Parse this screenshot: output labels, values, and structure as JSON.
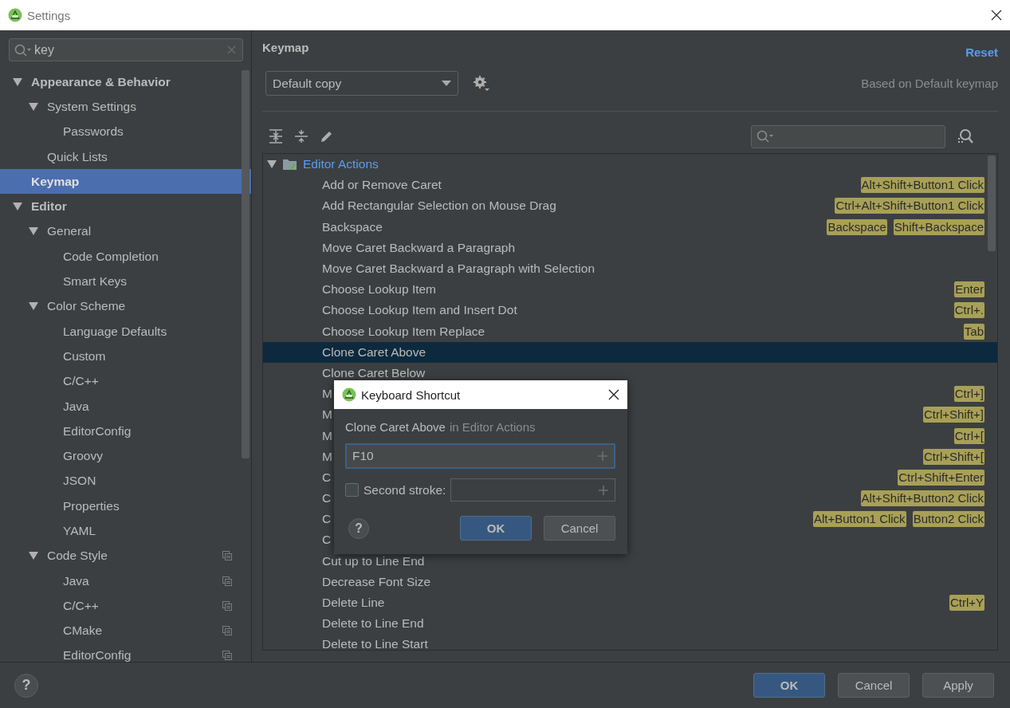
{
  "window": {
    "title": "Settings"
  },
  "sidebar": {
    "search": {
      "value": "key"
    },
    "tree": [
      {
        "label": "Appearance & Behavior",
        "selected": false,
        "expanded": true,
        "children": [
          {
            "label": "System Settings",
            "selected": false,
            "expanded": true,
            "children": [
              {
                "label": "Passwords",
                "selected": false
              }
            ]
          },
          {
            "label": "Quick Lists",
            "selected": false
          }
        ]
      },
      {
        "label": "Keymap",
        "selected": true
      },
      {
        "label": "Editor",
        "selected": false,
        "expanded": true,
        "children": [
          {
            "label": "General",
            "selected": false,
            "expanded": true,
            "children": [
              {
                "label": "Code Completion",
                "selected": false
              },
              {
                "label": "Smart Keys",
                "selected": false
              }
            ]
          },
          {
            "label": "Color Scheme",
            "selected": false,
            "expanded": true,
            "children": [
              {
                "label": "Language Defaults",
                "selected": false
              },
              {
                "label": "Custom",
                "selected": false
              },
              {
                "label": "C/C++",
                "selected": false
              },
              {
                "label": "Java",
                "selected": false
              },
              {
                "label": "EditorConfig",
                "selected": false
              },
              {
                "label": "Groovy",
                "selected": false
              },
              {
                "label": "JSON",
                "selected": false
              },
              {
                "label": "Properties",
                "selected": false
              },
              {
                "label": "YAML",
                "selected": false
              }
            ]
          },
          {
            "label": "Code Style",
            "selected": false,
            "expanded": true,
            "copy_icon": true,
            "children": [
              {
                "label": "Java",
                "selected": false,
                "copy_icon": true
              },
              {
                "label": "C/C++",
                "selected": false,
                "copy_icon": true
              },
              {
                "label": "CMake",
                "selected": false,
                "copy_icon": true
              },
              {
                "label": "EditorConfig",
                "selected": false,
                "copy_icon": true
              }
            ]
          }
        ]
      }
    ]
  },
  "keymap": {
    "title": "Keymap",
    "reset": "Reset",
    "scheme": "Default copy",
    "based_on": "Based on Default keymap",
    "group": {
      "label": "Editor Actions",
      "expanded": true
    },
    "actions": [
      {
        "name": "Add or Remove Caret",
        "selected": false,
        "shortcuts": [
          "Alt+Shift+Button1 Click"
        ]
      },
      {
        "name": "Add Rectangular Selection on Mouse Drag",
        "selected": false,
        "shortcuts": [
          "Ctrl+Alt+Shift+Button1 Click"
        ]
      },
      {
        "name": "Backspace",
        "selected": false,
        "shortcuts": [
          "Backspace",
          "Shift+Backspace"
        ]
      },
      {
        "name": "Move Caret Backward a Paragraph",
        "selected": false
      },
      {
        "name": "Move Caret Backward a Paragraph with Selection",
        "selected": false
      },
      {
        "name": "Choose Lookup Item",
        "selected": false,
        "shortcuts": [
          "Enter"
        ]
      },
      {
        "name": "Choose Lookup Item and Insert Dot",
        "selected": false,
        "shortcuts": [
          "Ctrl+."
        ]
      },
      {
        "name": "Choose Lookup Item Replace",
        "selected": false,
        "shortcuts": [
          "Tab"
        ]
      },
      {
        "name": "Clone Caret Above",
        "selected": true
      },
      {
        "name": "Clone Caret Below",
        "selected": false
      },
      {
        "name": "M",
        "selected": false,
        "shortcuts": [
          "Ctrl+]"
        ]
      },
      {
        "name": "M",
        "selected": false,
        "shortcuts": [
          "Ctrl+Shift+]"
        ]
      },
      {
        "name": "M",
        "selected": false,
        "shortcuts": [
          "Ctrl+["
        ]
      },
      {
        "name": "M",
        "selected": false,
        "shortcuts": [
          "Ctrl+Shift+["
        ]
      },
      {
        "name": "C",
        "selected": false,
        "shortcuts": [
          "Ctrl+Shift+Enter"
        ]
      },
      {
        "name": "C",
        "selected": false,
        "shortcuts": [
          "Alt+Shift+Button2 Click"
        ]
      },
      {
        "name": "C",
        "selected": false,
        "shortcuts": [
          "Alt+Button1 Click",
          "Button2 Click"
        ]
      },
      {
        "name": "C",
        "selected": false
      },
      {
        "name": "Cut up to Line End",
        "selected": false
      },
      {
        "name": "Decrease Font Size",
        "selected": false
      },
      {
        "name": "Delete Line",
        "selected": false,
        "shortcuts": [
          "Ctrl+Y"
        ]
      },
      {
        "name": "Delete to Line End",
        "selected": false
      },
      {
        "name": "Delete to Line Start",
        "selected": false
      }
    ]
  },
  "dialog": {
    "title": "Keyboard Shortcut",
    "action": "Clone Caret Above",
    "context": "in Editor Actions",
    "first_stroke": {
      "value": "F10",
      "focused": true
    },
    "second_stroke": {
      "label": "Second stroke:",
      "checked": false
    },
    "help": "?",
    "buttons": [
      {
        "label": "OK",
        "default": true
      },
      {
        "label": "Cancel",
        "default": false
      }
    ]
  },
  "help": "?",
  "buttons": [
    {
      "label": "OK",
      "default": true
    },
    {
      "label": "Cancel",
      "default": false
    },
    {
      "label": "Apply",
      "default": false
    }
  ]
}
